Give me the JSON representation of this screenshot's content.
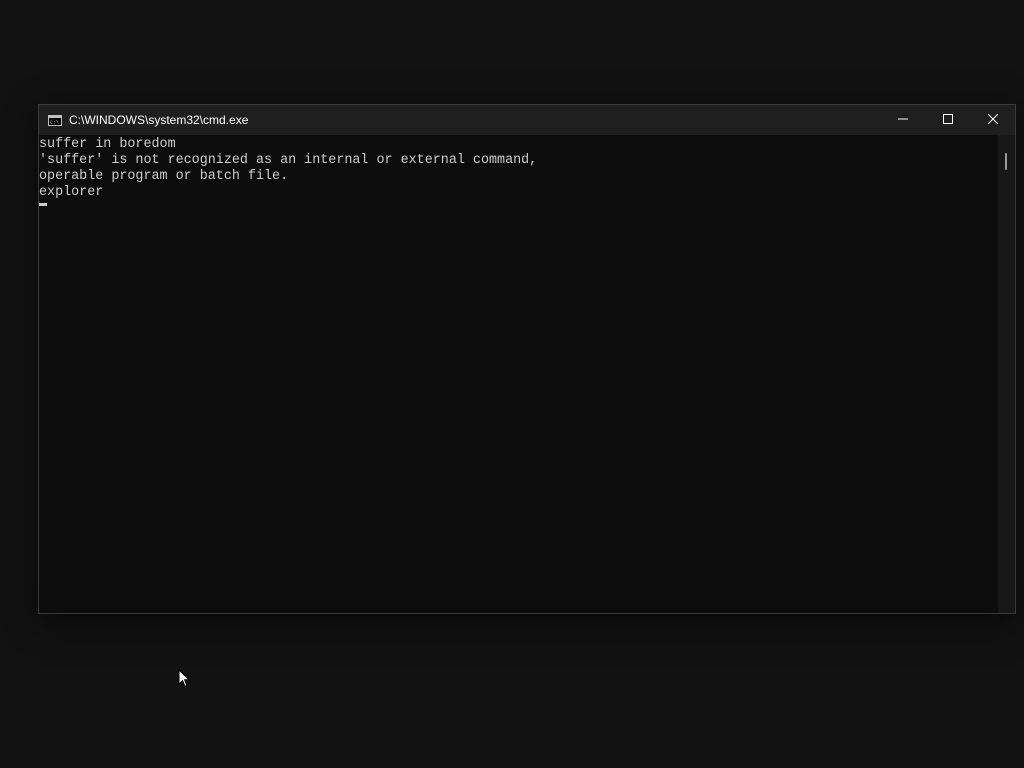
{
  "window": {
    "title": "C:\\WINDOWS\\system32\\cmd.exe",
    "app_icon": "console-icon"
  },
  "caption_buttons": {
    "minimize_icon": "minimize-icon",
    "maximize_icon": "maximize-icon",
    "close_icon": "close-icon"
  },
  "console": {
    "lines": [
      "suffer in boredom",
      "'suffer' is not recognized as an internal or external command,",
      "operable program or batch file.",
      "explorer"
    ]
  },
  "colors": {
    "desktop_background": "#121212",
    "console_background": "#0c0c0c",
    "console_text": "#cccccc",
    "titlebar": "#1f1f1f"
  }
}
